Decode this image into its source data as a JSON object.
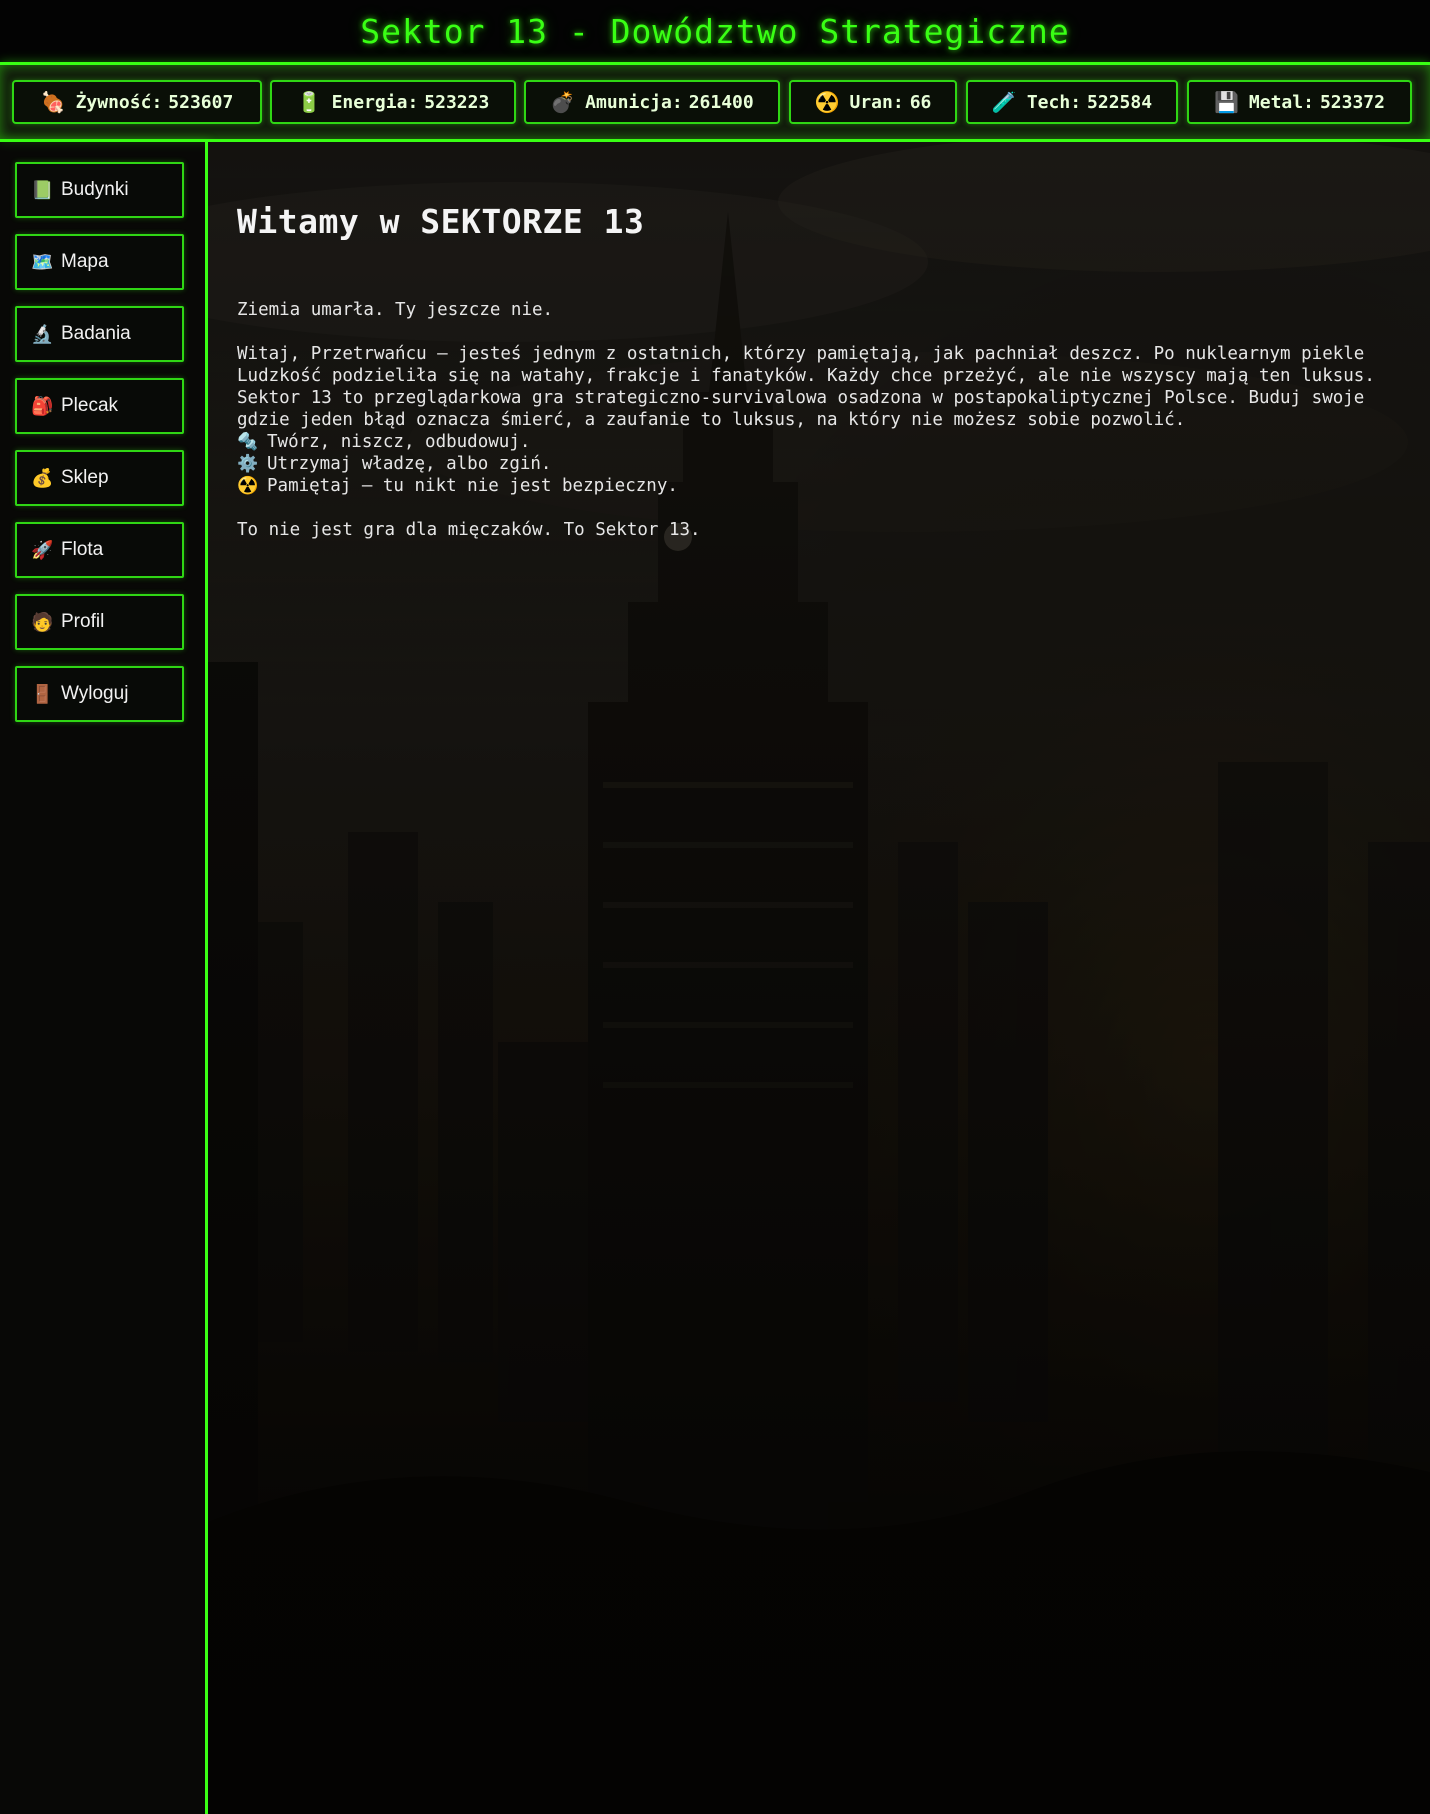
{
  "header": {
    "title": "Sektor 13 - Dowództwo Strategiczne"
  },
  "resources": [
    {
      "icon": "🍖",
      "icon_name": "meat-icon",
      "label": "Żywność",
      "value": "523607"
    },
    {
      "icon": "🔋",
      "icon_name": "battery-icon",
      "label": "Energia",
      "value": "523223"
    },
    {
      "icon": "💣",
      "icon_name": "bomb-icon",
      "label": "Amunicja",
      "value": "261400"
    },
    {
      "icon": "☢️",
      "icon_name": "radiation-icon",
      "label": "Uran",
      "value": "66"
    },
    {
      "icon": "🧪",
      "icon_name": "tech-icon",
      "label": "Tech",
      "value": "522584"
    },
    {
      "icon": "💾",
      "icon_name": "floppy-disk-icon",
      "label": "Metal",
      "value": "523372"
    }
  ],
  "sidebar": {
    "items": [
      {
        "icon": "📗",
        "icon_name": "green-book-icon",
        "label": "Budynki"
      },
      {
        "icon": "🗺️",
        "icon_name": "map-icon",
        "label": "Mapa"
      },
      {
        "icon": "🔬",
        "icon_name": "microscope-icon",
        "label": "Badania"
      },
      {
        "icon": "🎒",
        "icon_name": "backpack-icon",
        "label": "Plecak"
      },
      {
        "icon": "💰",
        "icon_name": "money-bag-icon",
        "label": "Sklep"
      },
      {
        "icon": "🚀",
        "icon_name": "rocket-icon",
        "label": "Flota"
      },
      {
        "icon": "🧑",
        "icon_name": "person-icon",
        "label": "Profil"
      },
      {
        "icon": "🚪",
        "icon_name": "door-icon",
        "label": "Wyloguj"
      }
    ]
  },
  "main": {
    "heading": "Witamy w SEKTORZE 13",
    "tagline": "Ziemia umarła. Ty jeszcze nie.",
    "story": [
      "Witaj, Przetrwańcu – jesteś jednym z ostatnich, którzy pamiętają, jak pachniał deszcz. Po nuklearnym piekle",
      "Ludzkość podzieliła się na watahy, frakcje i fanatyków. Każdy chce przeżyć, ale nie wszyscy mają ten luksus.",
      "Sektor 13 to przeglądarkowa gra strategiczno-survivalowa osadzona w postapokaliptycznej Polsce. Buduj swoje",
      "gdzie jeden błąd oznacza śmierć, a zaufanie to luksus, na który nie możesz sobie pozwolić."
    ],
    "bullets": [
      {
        "icon": "🔩",
        "icon_name": "nut-bolt-icon",
        "text": "Twórz, niszcz, odbudowuj."
      },
      {
        "icon": "⚙️",
        "icon_name": "gear-icon",
        "text": "Utrzymaj władzę, albo zgiń."
      },
      {
        "icon": "☢️",
        "icon_name": "radiation-icon",
        "text": "Pamiętaj – tu nikt nie jest bezpieczny."
      }
    ],
    "outro": "To nie jest gra dla mięczaków. To Sektor 13."
  },
  "colors": {
    "accent": "#39ff14",
    "background": "#0b0a08",
    "text": "#e6e6e6"
  }
}
